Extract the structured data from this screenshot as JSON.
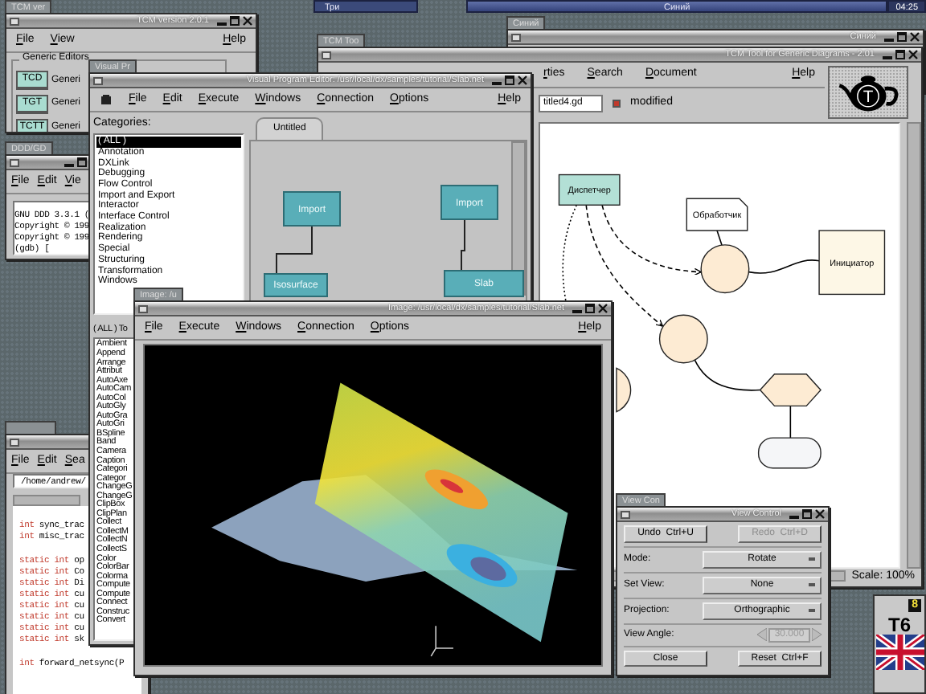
{
  "taskbar": {
    "desks": [
      {
        "label": "Три",
        "selected": false
      },
      {
        "label": "Синий",
        "selected": true
      }
    ],
    "clock": "04:25"
  },
  "tcm": {
    "tab": "TCM ver",
    "title": "TCM version 2.0.1",
    "menu": [
      "File",
      "View"
    ],
    "help": "Help",
    "group": "Generic Editors",
    "editors": [
      {
        "button": "TCD",
        "label": "Generi"
      },
      {
        "button": "TGT",
        "label": "Generi"
      },
      {
        "button": "TCTT",
        "label": "Generi"
      }
    ]
  },
  "gdb": {
    "tab": "DDD/GD",
    "menu": [
      "File",
      "Edit",
      "Vie"
    ],
    "lines": [
      "GNU DDD 3.3.1 (",
      "Copyright © 199",
      "Copyright © 199",
      "(gdb) ["
    ]
  },
  "sinij": {
    "tab": "Синий",
    "title": "Синий"
  },
  "diagram": {
    "tab": "TCM Too",
    "title": "TCM Tool for Generic Diagrams - 2.01",
    "menu": [
      "rties",
      "Search",
      "Document"
    ],
    "help": "Help",
    "logo": "T",
    "file": "titled4.gd",
    "modified": {
      "label": "modified",
      "checked": true
    },
    "nodes": [
      {
        "kind": "box",
        "label": "Диспетчер",
        "color": "#b3e0d6"
      },
      {
        "kind": "note",
        "label": "Обработчик",
        "color": "#ffffff"
      },
      {
        "kind": "circle",
        "color": "#fdebd3"
      },
      {
        "kind": "box",
        "label": "Инициатор",
        "color": "#fdf7e6"
      },
      {
        "kind": "circle",
        "color": "#fdebd3"
      },
      {
        "kind": "circle",
        "color": "#fdebd3"
      },
      {
        "kind": "hexagon",
        "color": "#fdebd3"
      },
      {
        "kind": "rounded",
        "color": "#f5f6f8"
      }
    ],
    "scale": "Scale: 100%"
  },
  "editor": {
    "menu": [
      "File",
      "Edit",
      "Sea"
    ],
    "path": "/home/andrew/",
    "code": [
      [
        {
          "type": "int",
          "rest": "sync_trac"
        },
        {
          "type": "int",
          "rest": "misc_trac"
        }
      ],
      [
        {
          "type": "static int",
          "rest": "op"
        },
        {
          "type": "static int",
          "rest": "Co"
        },
        {
          "type": "static int",
          "rest": "Di"
        },
        {
          "type": "static int",
          "rest": "cu"
        },
        {
          "type": "static int",
          "rest": "cu"
        },
        {
          "type": "static int",
          "rest": "cu"
        },
        {
          "type": "static int",
          "rest": "cu"
        },
        {
          "type": "static int",
          "rest": "sk"
        }
      ],
      [
        {
          "type": "int",
          "rest": "forward_netsync(P"
        }
      ]
    ]
  },
  "vpe": {
    "tab": "Visual Pr",
    "title": "Visual Program Editor: /usr/local/dx/samples/tutorial/Slab.net",
    "menu": [
      "File",
      "Edit",
      "Execute",
      "Windows",
      "Connection",
      "Options"
    ],
    "help": "Help",
    "categories_label": "Categories:",
    "categories": [
      {
        "label": "( ALL )",
        "selected": true
      },
      {
        "label": "Annotation",
        "selected": false
      },
      {
        "label": "DXLink",
        "selected": false
      },
      {
        "label": "Debugging",
        "selected": false
      },
      {
        "label": "Flow Control",
        "selected": false
      },
      {
        "label": "Import and Export",
        "selected": false
      },
      {
        "label": "Interactor",
        "selected": false
      },
      {
        "label": "Interface Control",
        "selected": false
      },
      {
        "label": "Realization",
        "selected": false
      },
      {
        "label": "Rendering",
        "selected": false
      },
      {
        "label": "Special",
        "selected": false
      },
      {
        "label": "Structuring",
        "selected": false
      },
      {
        "label": "Transformation",
        "selected": false
      },
      {
        "label": "Windows",
        "selected": false
      }
    ],
    "canvas_tab": "Untitled",
    "modules": [
      "Import",
      "Import",
      "Isosurface",
      "Slab"
    ],
    "tools_label": "( ALL ) To",
    "tools": [
      "Ambient",
      "Append",
      "Arrange",
      "Attribut",
      "AutoAxe",
      "AutoCam",
      "AutoCol",
      "AutoGly",
      "AutoGra",
      "AutoGri",
      "BSpline",
      "Band",
      "Camera",
      "Caption",
      "Categori",
      "Categor",
      "ChangeG",
      "ChangeG",
      "ClipBox",
      "ClipPlan",
      "Collect",
      "CollectM",
      "CollectN",
      "CollectS",
      "Color",
      "ColorBar",
      "Colorma",
      "Compute",
      "Compute",
      "Connect",
      "Construc",
      "Convert"
    ]
  },
  "image": {
    "tab": "Image: /u",
    "title": "Image: /usr/local/dx/samples/tutorial/Slab.net",
    "menu": [
      "File",
      "Execute",
      "Windows",
      "Connection",
      "Options"
    ],
    "help": "Help"
  },
  "view_control": {
    "tab": "View Con",
    "title": "View Control",
    "top_buttons": [
      {
        "label": "Undo  Ctrl+U",
        "disabled": false
      },
      {
        "label": "Redo  Ctrl+D",
        "disabled": true
      }
    ],
    "rows": [
      {
        "kind": "option",
        "label": "Mode:",
        "value": "Rotate"
      },
      {
        "kind": "option",
        "label": "Set View:",
        "value": "None"
      },
      {
        "kind": "option",
        "label": "Projection:",
        "value": "Orthographic"
      },
      {
        "kind": "stepper",
        "label": "View Angle:",
        "value": "30.000",
        "disabled": true
      }
    ],
    "bottom_buttons": [
      {
        "label": "Close",
        "disabled": false
      },
      {
        "label": "Reset  Ctrl+F",
        "disabled": false
      }
    ]
  },
  "keyboard": {
    "indicator": "8",
    "layout": "T6"
  }
}
